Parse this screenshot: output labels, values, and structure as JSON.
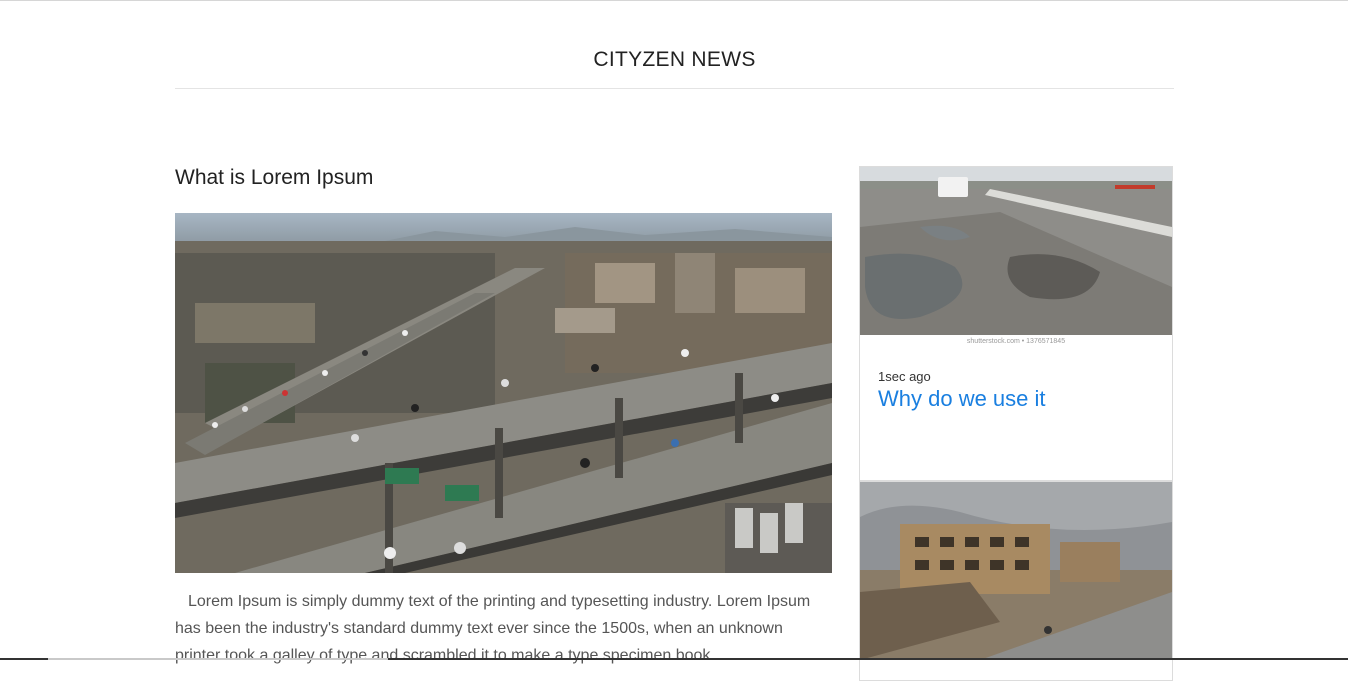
{
  "header": {
    "site_title": "CITYZEN NEWS"
  },
  "main_article": {
    "title": "What is Lorem Ipsum",
    "image": "highway-interchange-aerial-photo",
    "body": "Lorem Ipsum is simply dummy text of the printing and typesetting industry. Lorem Ipsum has been the industry's standard dummy text ever since the 1500s, when an unknown printer took a galley of type and scrambled it to make a type specimen book."
  },
  "sidebar": {
    "cards": [
      {
        "image": "potholed-road-photo",
        "watermark": "shutterstock.com • 1376571845",
        "time": "1sec ago",
        "title": "Why do we use it"
      },
      {
        "image": "destroyed-buildings-photo"
      }
    ]
  },
  "colors": {
    "link": "#1a7fe0",
    "text": "#222222",
    "body_text": "#555555"
  }
}
